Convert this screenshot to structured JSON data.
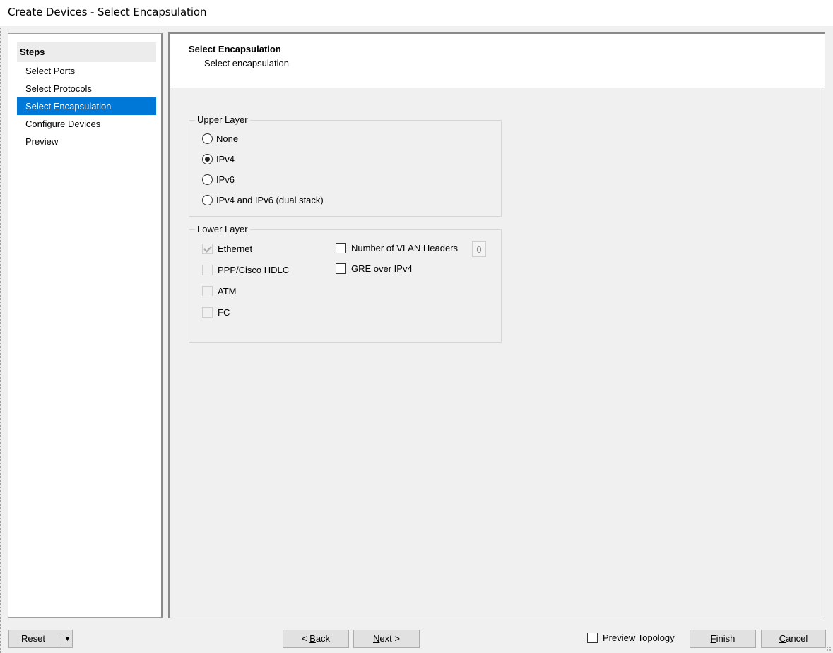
{
  "window": {
    "title": "Create Devices - Select Encapsulation"
  },
  "steps": {
    "header": "Steps",
    "items": [
      {
        "label": "Select Ports",
        "active": false
      },
      {
        "label": "Select Protocols",
        "active": false
      },
      {
        "label": "Select Encapsulation",
        "active": true
      },
      {
        "label": "Configure Devices",
        "active": false
      },
      {
        "label": "Preview",
        "active": false
      }
    ]
  },
  "page": {
    "title": "Select Encapsulation",
    "subtitle": "Select encapsulation"
  },
  "upper_layer": {
    "label": "Upper Layer",
    "options": [
      {
        "label": "None",
        "selected": false
      },
      {
        "label": "IPv4",
        "selected": true
      },
      {
        "label": "IPv6",
        "selected": false
      },
      {
        "label": "IPv4 and IPv6 (dual stack)",
        "selected": false
      }
    ]
  },
  "lower_layer": {
    "label": "Lower Layer",
    "left_options": [
      {
        "label": "Ethernet",
        "checked": true,
        "enabled": false
      },
      {
        "label": "PPP/Cisco HDLC",
        "checked": false,
        "enabled": false
      },
      {
        "label": "ATM",
        "checked": false,
        "enabled": false
      },
      {
        "label": "FC",
        "checked": false,
        "enabled": false
      }
    ],
    "vlan_headers": {
      "label": "Number of VLAN Headers",
      "checked": false,
      "value": "0"
    },
    "gre": {
      "label": "GRE over IPv4",
      "checked": false
    }
  },
  "footer": {
    "reset_label": "Reset",
    "back": {
      "prefix": "< ",
      "accel": "B",
      "rest": "ack"
    },
    "next": {
      "accel": "N",
      "rest": "ext >"
    },
    "preview_topology": {
      "label": "Preview Topology",
      "checked": false
    },
    "finish": {
      "accel": "F",
      "rest": "inish"
    },
    "cancel": {
      "accel": "C",
      "rest": "ancel"
    }
  }
}
